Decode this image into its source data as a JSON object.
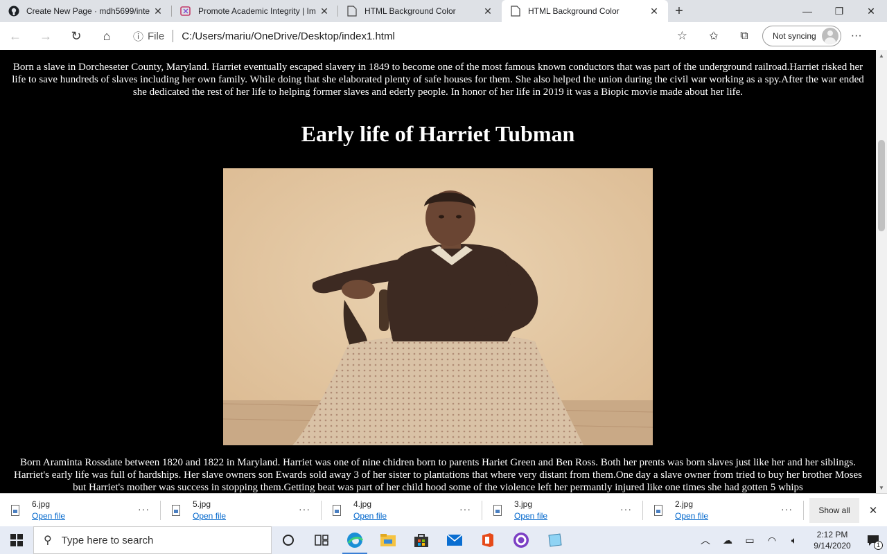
{
  "browser": {
    "tabs": [
      {
        "title": "Create New Page · mdh5699/inte",
        "icon": "github-icon"
      },
      {
        "title": "Promote Academic Integrity | Im",
        "icon": "integrity-icon"
      },
      {
        "title": "HTML Background Color",
        "icon": "page-icon"
      },
      {
        "title": "HTML Background Color",
        "icon": "page-icon",
        "active": true
      }
    ],
    "address": {
      "scheme": "File",
      "url": "C:/Users/mariu/OneDrive/Desktop/index1.html"
    },
    "profile_label": "Not syncing"
  },
  "page": {
    "intro": "Born a slave in Dorcheseter County, Maryland. Harriet eventually escaped slavery in 1849 to become one of the most famous known conductors that was part of the underground railroad.Harriet risked her life to save hundreds of slaves including her own family. While doing that she elaborated plenty of safe houses for them. She also helped the union during the civil war working as a spy.After the war ended she dedicated the rest of her life to helping former slaves and ederly people. In honor of her life in 2019 it was a Biopic movie made about her life.",
    "heading": "Early life of Harriet Tubman",
    "early_life": "Born Araminta Rossdate between 1820 and 1822 in Maryland. Harriet was one of nine chidren born to parents Hariet Green and Ben Ross. Both her prents was born slaves just like her and her siblings. Harriet's early life was full of hardships. Her slave owners son Ewards sold away 3 of her sister to plantations that where very distant from them.One day a slave owner from tried to buy her brother Moses but Harriet's mother was success in stopping them.Getting beat was part of her child hood some of the violence left her permantly injured like one times she had gotten 5 whips"
  },
  "downloads": {
    "items": [
      {
        "name": "6.jpg",
        "action": "Open file"
      },
      {
        "name": "5.jpg",
        "action": "Open file"
      },
      {
        "name": "4.jpg",
        "action": "Open file"
      },
      {
        "name": "3.jpg",
        "action": "Open file"
      },
      {
        "name": "2.jpg",
        "action": "Open file"
      }
    ],
    "show_all": "Show all"
  },
  "taskbar": {
    "search_placeholder": "Type here to search",
    "time": "2:12 PM",
    "date": "9/14/2020",
    "notification_count": "1"
  },
  "colors": {
    "page_bg": "#000000",
    "page_text": "#ffffff",
    "link": "#0066cc",
    "tabstrip_bg": "#dee1e6",
    "taskbar_bg": "#e6ebf5"
  }
}
